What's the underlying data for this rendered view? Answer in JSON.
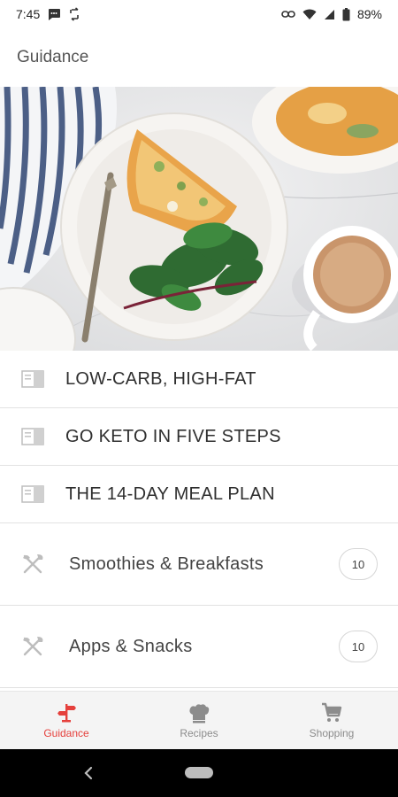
{
  "status_bar": {
    "time": "7:45",
    "battery": "89%"
  },
  "app_bar": {
    "title": "Guidance"
  },
  "guides": [
    {
      "label": "LOW-CARB, HIGH-FAT",
      "icon": "document-icon"
    },
    {
      "label": "GO KETO IN FIVE STEPS",
      "icon": "document-icon"
    },
    {
      "label": "THE 14-DAY MEAL PLAN",
      "icon": "document-icon"
    }
  ],
  "categories": [
    {
      "label": "Smoothies & Breakfasts",
      "count": "10",
      "icon": "fork-knife-icon"
    },
    {
      "label": "Apps & Snacks",
      "count": "10",
      "icon": "fork-knife-icon"
    }
  ],
  "bottom_nav": {
    "items": [
      {
        "label": "Guidance",
        "icon": "signpost-icon",
        "active": true
      },
      {
        "label": "Recipes",
        "icon": "chef-hat-icon",
        "active": false
      },
      {
        "label": "Shopping",
        "icon": "cart-icon",
        "active": false
      }
    ]
  },
  "colors": {
    "accent": "#e5403c",
    "inactive": "#8c8c8c"
  }
}
